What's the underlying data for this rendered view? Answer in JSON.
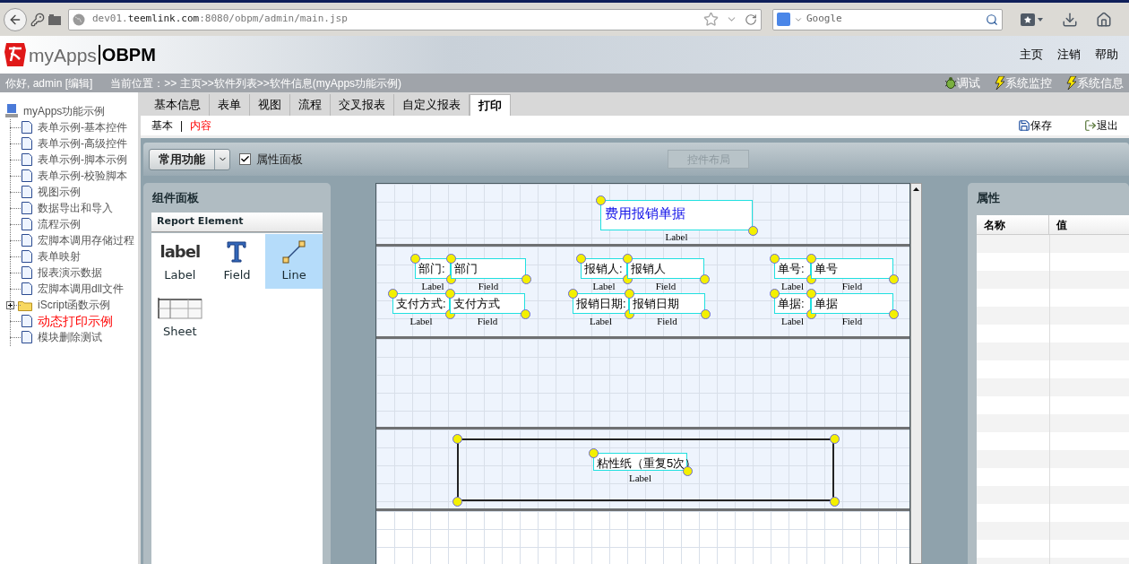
{
  "browser": {
    "url": "dev01.**teemlink.com**:8080/obpm/admin/main.jsp",
    "search_placeholder": "Google"
  },
  "header": {
    "logo": "myApps",
    "product": "OBPM",
    "links": [
      "主页",
      "注销",
      "帮助"
    ]
  },
  "infobar": {
    "greeting": "你好, admin [编辑]",
    "location": "当前位置：>> 主页>>软件列表>>软件信息(myApps功能示例)",
    "tools": [
      {
        "kind": "bug",
        "label": "调试"
      },
      {
        "kind": "bolt",
        "label": "系统监控"
      },
      {
        "kind": "bolt",
        "label": "系统信息"
      }
    ]
  },
  "sidebar": {
    "root": "myApps功能示例",
    "items": [
      {
        "kind": "page",
        "label": "表单示例-基本控件",
        "selected": false
      },
      {
        "kind": "page",
        "label": "表单示例-高级控件",
        "selected": false
      },
      {
        "kind": "page",
        "label": "表单示例-脚本示例",
        "selected": false
      },
      {
        "kind": "page",
        "label": "表单示例-校验脚本",
        "selected": false
      },
      {
        "kind": "page",
        "label": "视图示例",
        "selected": false
      },
      {
        "kind": "page",
        "label": "数据导出和导入",
        "selected": false
      },
      {
        "kind": "page",
        "label": "流程示例",
        "selected": false
      },
      {
        "kind": "page",
        "label": "宏脚本调用存储过程",
        "selected": false
      },
      {
        "kind": "page",
        "label": "表单映射",
        "selected": false
      },
      {
        "kind": "page",
        "label": "报表演示数据",
        "selected": false
      },
      {
        "kind": "page",
        "label": "宏脚本调用dll文件",
        "selected": false
      },
      {
        "kind": "folder",
        "label": "iScript函数示例",
        "selected": false,
        "expanded": false
      },
      {
        "kind": "page",
        "label": "动态打印示例",
        "selected": true
      },
      {
        "kind": "page",
        "label": "模块删除测试",
        "selected": false
      }
    ]
  },
  "tabs": [
    {
      "label": "基本信息",
      "selected": false
    },
    {
      "label": "表单",
      "selected": false
    },
    {
      "label": "视图",
      "selected": false
    },
    {
      "label": "流程",
      "selected": false
    },
    {
      "label": "交叉报表",
      "selected": false
    },
    {
      "label": "自定义报表",
      "selected": false
    },
    {
      "label": "打印",
      "selected": true
    }
  ],
  "subtabs": [
    {
      "label": "基本",
      "selected": false
    },
    {
      "label": "内容",
      "selected": true
    }
  ],
  "subtab_separator": "|",
  "actions": [
    {
      "kind": "save",
      "label": "保存"
    },
    {
      "kind": "exit",
      "label": "退出"
    }
  ],
  "toolbar": {
    "menu": "常用功能",
    "checkbox": {
      "label": "属性面板",
      "checked": true
    },
    "button": {
      "label": "控件布局",
      "disabled": true
    }
  },
  "palette": {
    "title": "组件面板",
    "section": "Report Element",
    "items": [
      {
        "kind": "label",
        "icon_text": "label",
        "label": "Label",
        "selected": false
      },
      {
        "kind": "field",
        "label": "Field",
        "selected": false
      },
      {
        "kind": "line",
        "label": "Line",
        "selected": true
      },
      {
        "kind": "sheet",
        "label": "Sheet",
        "selected": false
      }
    ]
  },
  "canvas": {
    "bands": [
      {
        "kind": "band",
        "elements": [
          {
            "kind": "title",
            "text": "费用报销单据",
            "caption": "Label"
          }
        ]
      },
      {
        "kind": "band",
        "elements": [
          {
            "kind": "label",
            "text": "部门:",
            "caption": "Label"
          },
          {
            "kind": "field",
            "text": "部门",
            "caption": "Field"
          },
          {
            "kind": "label",
            "text": "报销人:",
            "caption": "Label"
          },
          {
            "kind": "field",
            "text": "报销人",
            "caption": "Field"
          },
          {
            "kind": "label",
            "text": "单号:",
            "caption": "Label"
          },
          {
            "kind": "field",
            "text": "单号",
            "caption": "Field"
          },
          {
            "kind": "label",
            "text": "支付方式:",
            "caption": "Label"
          },
          {
            "kind": "field",
            "text": "支付方式",
            "caption": "Field"
          },
          {
            "kind": "label",
            "text": "报销日期:",
            "caption": "Label"
          },
          {
            "kind": "field",
            "text": "报销日期",
            "caption": "Field"
          },
          {
            "kind": "label",
            "text": "单据:",
            "caption": "Label"
          },
          {
            "kind": "field",
            "text": "单据",
            "caption": "Field"
          }
        ]
      },
      {
        "kind": "band"
      },
      {
        "kind": "band",
        "elements": [
          {
            "kind": "rect"
          },
          {
            "kind": "label",
            "text": "粘性纸（重复5次）",
            "caption": "Label"
          }
        ]
      },
      {
        "kind": "unused_area"
      }
    ]
  },
  "properties": {
    "title": "属性",
    "columns": [
      "名称",
      "值"
    ]
  }
}
